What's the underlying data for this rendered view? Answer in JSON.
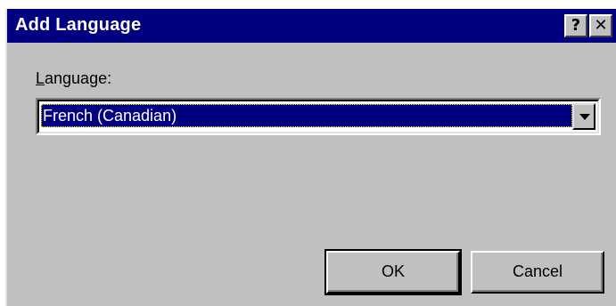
{
  "window": {
    "title": "Add Language",
    "help_glyph": "?",
    "close_glyph": "✕"
  },
  "form": {
    "language_label_mnemonic": "L",
    "language_label_rest": "anguage:",
    "language_selected": "French (Canadian)"
  },
  "buttons": {
    "ok_label": "OK",
    "cancel_label": "Cancel"
  },
  "colors": {
    "titlebar": "#000080",
    "dialog_bg": "#c0c0c0",
    "selection_bg": "#000080"
  },
  "icons": {
    "help": "question-mark-icon",
    "close": "close-icon",
    "dropdown": "chevron-down-icon"
  }
}
